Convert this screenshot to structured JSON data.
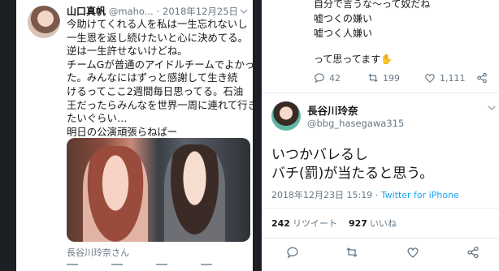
{
  "left_tweet": {
    "display_name": "山口真帆",
    "handle": "@maho...",
    "separator": "·",
    "date": "2018年12月25日",
    "lines": [
      "今助けてくれる人を私は一生忘れないし",
      "一生恩を返し続けたいと心に決めてる。",
      "逆は一生許せないけどね。",
      "チームGが普通のアイドルチームでよかっ",
      "た。みんなにはずっと感謝して生き続",
      "けるってここ2週間毎日思ってる。石油",
      "王だったらみんなを世界一周に連れて行き",
      "たいぐらい…",
      "明日の公演頑張らねばー"
    ],
    "photo_caption": "長谷川玲奈さん"
  },
  "right_top": {
    "lines": [
      "自分で言うな〜って奴だね",
      "嘘つくの嫌い",
      "嘘つく人嫌い"
    ],
    "thanks_line": "って思ってます",
    "thanks_emoji": "✋",
    "reply_count": "42",
    "retweet_count": "199",
    "like_count": "1,111"
  },
  "right_tweet": {
    "display_name": "長谷川玲奈",
    "handle": "@bbg_hasegawa315",
    "lines": [
      "いつかバレるし",
      "バチ(罰)が当たると思う。"
    ],
    "timestamp": "2018年12月23日 15:19",
    "via": "Twitter for iPhone",
    "retweets_num": "242",
    "retweets_label": "リツイート",
    "likes_num": "927",
    "likes_label": "いいね"
  },
  "colors": {
    "background": "#1c1f24",
    "card": "#ffffff",
    "text": "#14171a",
    "muted": "#657786",
    "link": "#1da1f2"
  },
  "icons": [
    "caret-down-icon",
    "reply-icon",
    "retweet-icon",
    "like-icon",
    "share-icon"
  ]
}
